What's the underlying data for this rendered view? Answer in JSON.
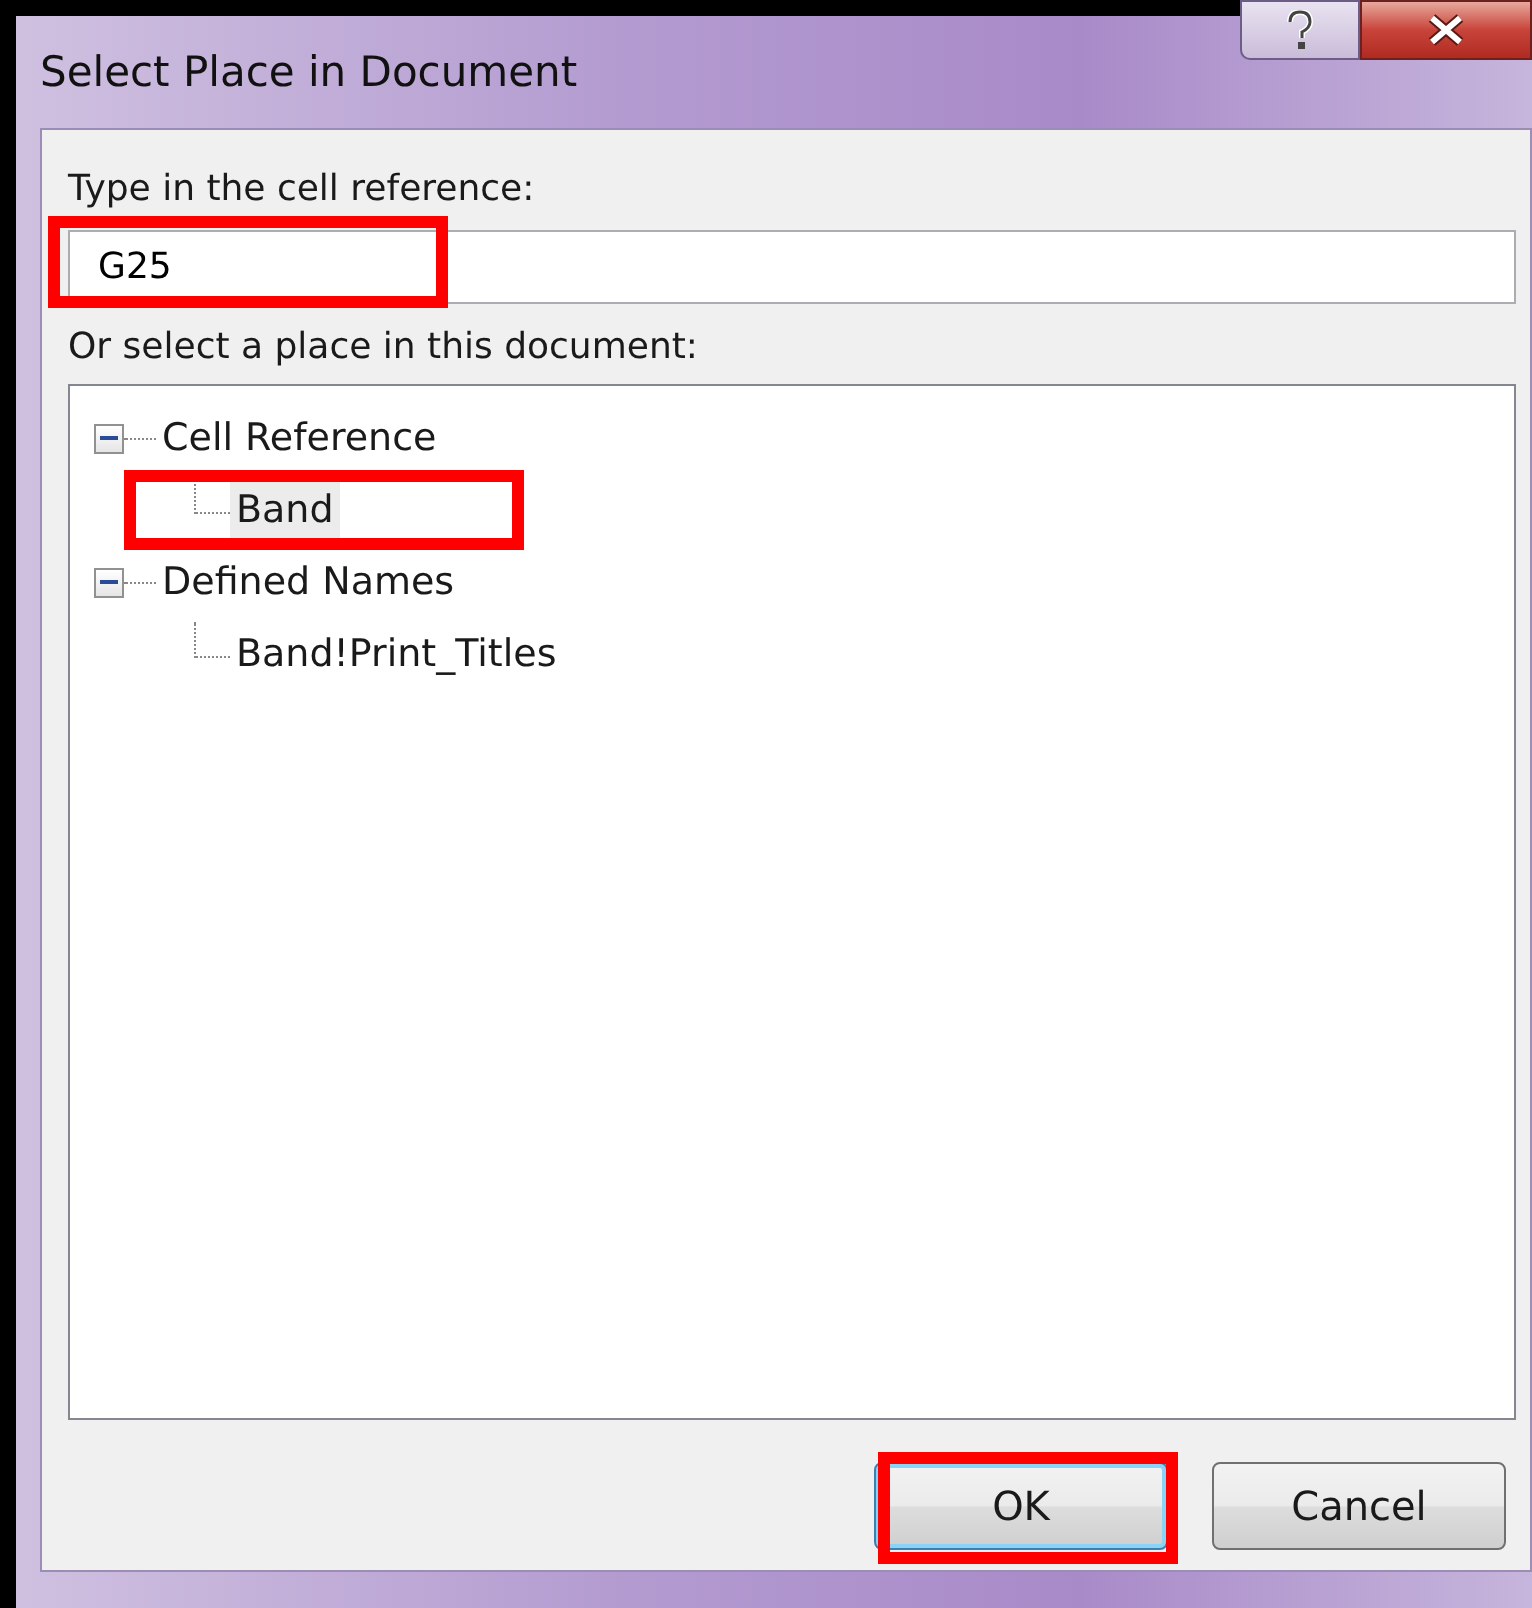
{
  "window": {
    "title": "Select Place in Document"
  },
  "reference": {
    "label": "Type in the cell reference:",
    "value": "G25",
    "highlighted": true
  },
  "place": {
    "label": "Or select a place in this document:",
    "tree": [
      {
        "label": "Cell Reference",
        "expanded": true,
        "selected": false,
        "highlighted": false,
        "children": [
          {
            "label": "Band",
            "selected": true,
            "highlighted": true
          }
        ]
      },
      {
        "label": "Defined Names",
        "expanded": true,
        "selected": false,
        "highlighted": false,
        "children": [
          {
            "label": "Band!Print_Titles",
            "selected": false,
            "highlighted": false
          }
        ]
      }
    ]
  },
  "buttons": [
    {
      "label": "OK",
      "default": true,
      "highlighted": true
    },
    {
      "label": "Cancel",
      "default": false,
      "highlighted": false
    }
  ]
}
